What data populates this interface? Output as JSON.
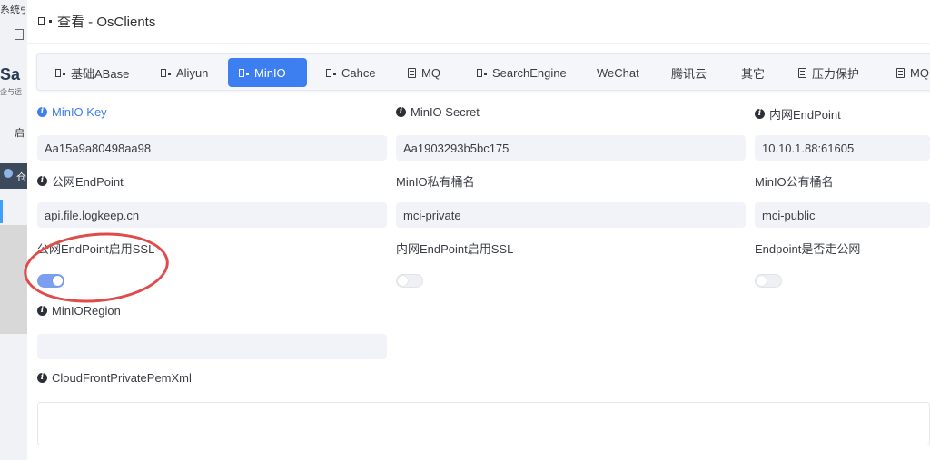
{
  "background_app": {
    "fragment_1": "系统引",
    "logo": "Sa",
    "logo_sub": "企与运",
    "fragment_2": "启",
    "fragment_3": "仓"
  },
  "dialog": {
    "title": "查看 - OsClients"
  },
  "tabs": [
    {
      "label": "基础ABase",
      "icon": "doc-icon"
    },
    {
      "label": "Aliyun",
      "icon": "doc-icon"
    },
    {
      "label": "MinIO",
      "icon": "doc-icon",
      "active": true
    },
    {
      "label": "Cahce",
      "icon": "doc-icon"
    },
    {
      "label": "MQ",
      "icon": "page-icon"
    },
    {
      "label": "SearchEngine",
      "icon": "doc-icon"
    },
    {
      "label": "WeChat",
      "icon": ""
    },
    {
      "label": "腾讯云",
      "icon": ""
    },
    {
      "label": "其它",
      "icon": ""
    },
    {
      "label": "压力保护",
      "icon": "page-icon"
    },
    {
      "label": "MQ",
      "icon": "page-icon"
    }
  ],
  "form": {
    "minio_key": {
      "label": "MinIO Key",
      "value": "Aa15a9a80498aa98"
    },
    "minio_secret": {
      "label": "MinIO Secret",
      "value": "Aa1903293b5bc175"
    },
    "internal_endpoint": {
      "label": "内网EndPoint",
      "value": "10.10.1.88:61605"
    },
    "public_endpoint": {
      "label": "公网EndPoint",
      "value": "api.file.logkeep.cn"
    },
    "private_bucket": {
      "label": "MinIO私有桶名",
      "value": "mci-private"
    },
    "public_bucket": {
      "label": "MinIO公有桶名",
      "value": "mci-public"
    },
    "public_ssl": {
      "label": "公网EndPoint启用SSL",
      "enabled": true
    },
    "internal_ssl": {
      "label": "内网EndPoint启用SSL",
      "enabled": false
    },
    "endpoint_public": {
      "label": "Endpoint是否走公网",
      "enabled": false
    },
    "region": {
      "label": "MinIORegion",
      "value": ""
    },
    "cloudfront_pem": {
      "label": "CloudFrontPrivatePemXml",
      "value": ""
    }
  },
  "colors": {
    "accent": "#3d7ff0",
    "annotation": "#e04b4b"
  }
}
